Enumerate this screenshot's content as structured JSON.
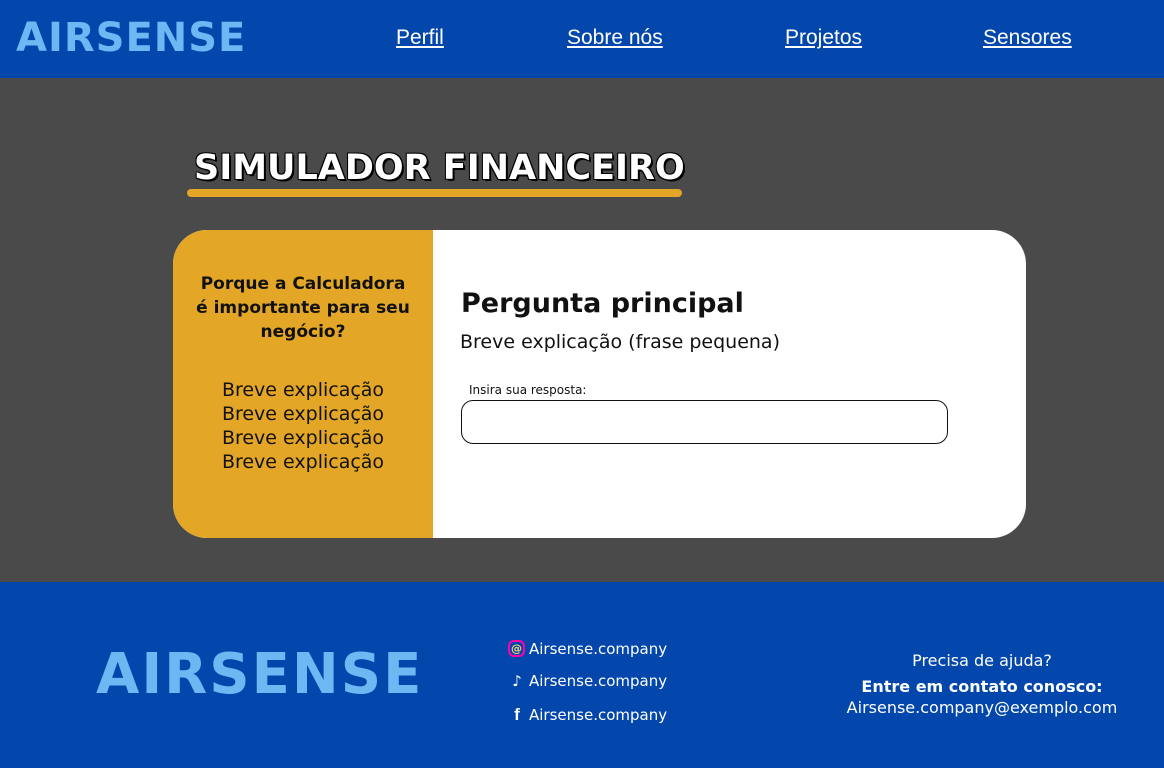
{
  "header": {
    "logo": "AIRSENSE",
    "nav": [
      "Perfil",
      "Sobre nós",
      "Projetos",
      "Sensores"
    ]
  },
  "page_title": "SIMULADOR FINANCEIRO",
  "sidebar": {
    "heading": "Porque a Calculadora é importante para seu negócio?",
    "items": [
      "Breve explicação",
      "Breve explicação",
      "Breve explicação",
      "Breve explicação"
    ]
  },
  "question": {
    "title": "Pergunta principal",
    "subtitle": "Breve explicação (frase pequena)",
    "input_label": "Insira sua resposta:",
    "input_value": ""
  },
  "footer": {
    "logo": "AIRSENSE",
    "social": [
      {
        "icon": "instagram-icon",
        "handle": "Airsense.company"
      },
      {
        "icon": "tiktok-icon",
        "handle": "Airsense.company"
      },
      {
        "icon": "facebook-icon",
        "handle": "Airsense.company"
      }
    ],
    "help": {
      "question": "Precisa de ajuda?",
      "cta": "Entre em contato conosco:",
      "email": "Airsense.company@exemplo.com"
    }
  },
  "colors": {
    "brand_blue": "#0347ad",
    "logo_blue": "#6cb8f3",
    "accent_gold": "#e3a626",
    "background_gray": "#4a4a4a"
  }
}
